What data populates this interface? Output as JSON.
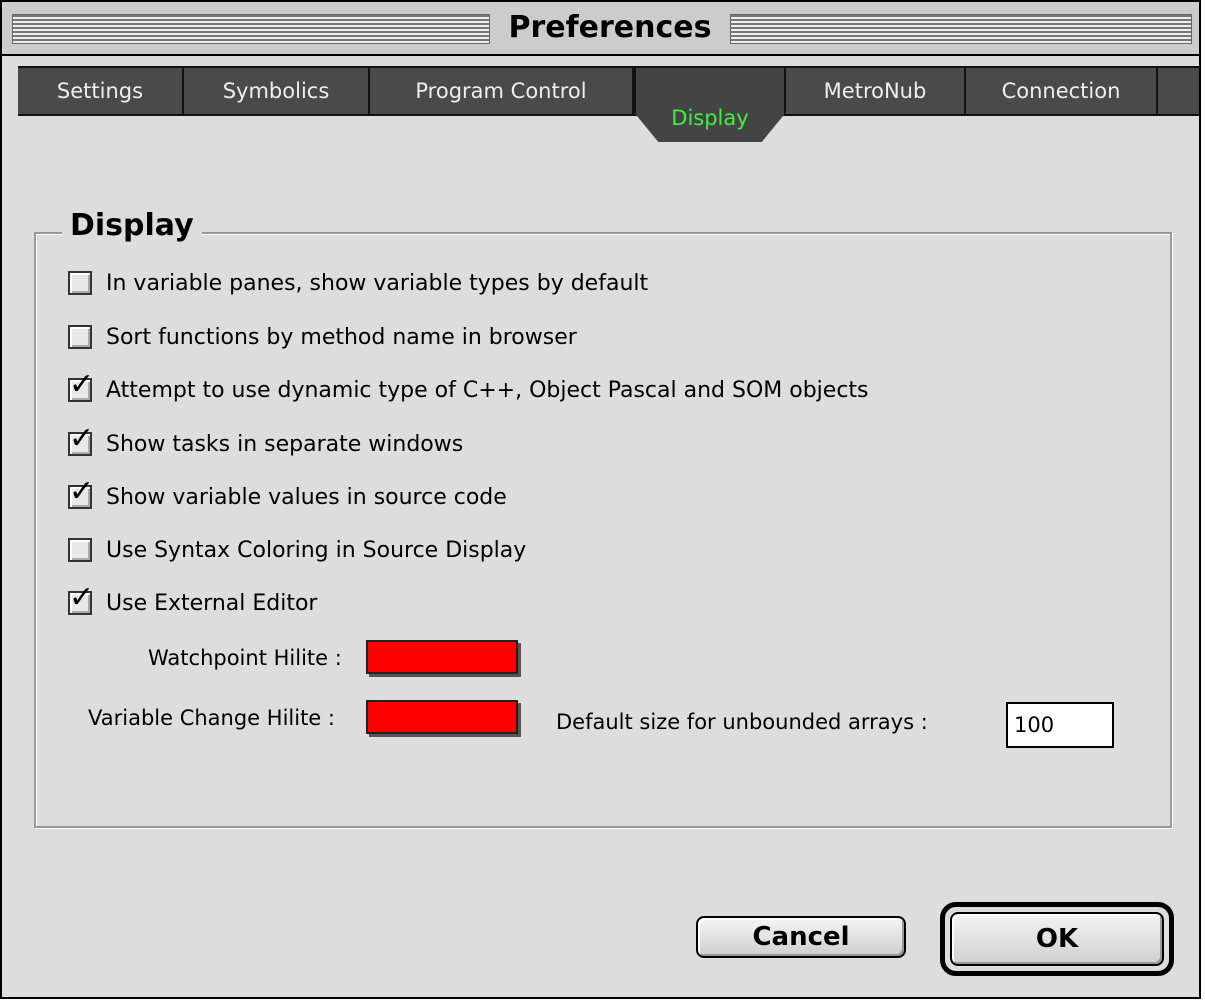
{
  "window": {
    "title": "Preferences"
  },
  "tabs": [
    {
      "label": "Settings",
      "active": false
    },
    {
      "label": "Symbolics",
      "active": false
    },
    {
      "label": "Program Control",
      "active": false
    },
    {
      "label": "Display",
      "active": true
    },
    {
      "label": "MetroNub",
      "active": false
    },
    {
      "label": "Connection",
      "active": false
    }
  ],
  "display_group": {
    "title": "Display",
    "options": [
      {
        "label": "In variable panes, show variable types by default",
        "checked": false
      },
      {
        "label": "Sort functions by method name in browser",
        "checked": false
      },
      {
        "label": "Attempt to use dynamic type of C++, Object Pascal and SOM objects",
        "checked": true
      },
      {
        "label": "Show tasks in separate windows",
        "checked": true
      },
      {
        "label": "Show variable values in source code",
        "checked": true
      },
      {
        "label": "Use Syntax Coloring in Source Display",
        "checked": false
      },
      {
        "label": "Use External Editor",
        "checked": true
      }
    ],
    "check_glyph": "✓",
    "watchpoint_hilite": {
      "label": "Watchpoint Hilite :",
      "color": "#ff0000"
    },
    "variable_change_hilite": {
      "label": "Variable Change Hilite :",
      "color": "#ff0000"
    },
    "array_size": {
      "label": "Default size for unbounded arrays :",
      "value": "100"
    }
  },
  "buttons": {
    "cancel": "Cancel",
    "ok": "OK"
  },
  "colors": {
    "active_tab_text": "#3df03d",
    "tab_strip": "#4a4a4a",
    "window_bg": "#dddddd"
  }
}
